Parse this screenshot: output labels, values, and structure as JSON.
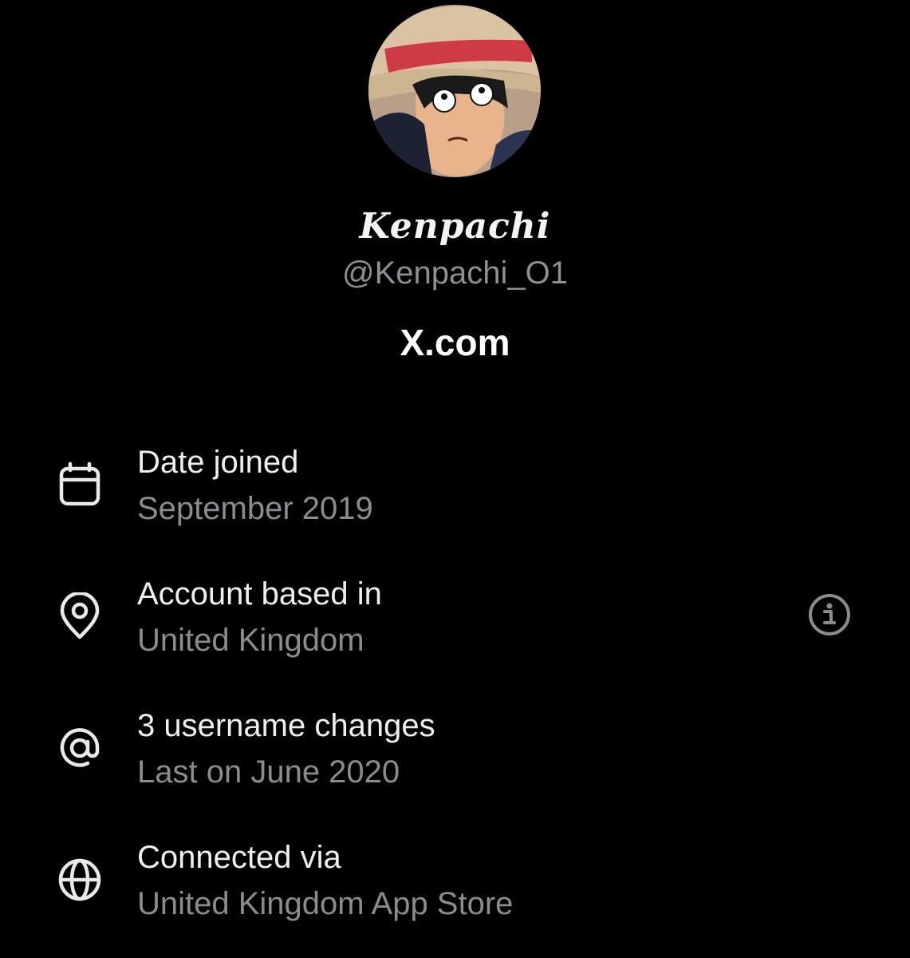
{
  "profile": {
    "display_name": "Kenpachi",
    "handle": "@Kenpachi_O1",
    "domain": "X.com",
    "avatar_icon": "anime-character-avatar"
  },
  "details": [
    {
      "icon": "calendar-icon",
      "title": "Date joined",
      "value": "September 2019"
    },
    {
      "icon": "location-pin-icon",
      "title": "Account based in",
      "value": "United Kingdom",
      "has_info": true
    },
    {
      "icon": "at-sign-icon",
      "title": "3 username changes",
      "value": "Last on June 2020"
    },
    {
      "icon": "globe-icon",
      "title": "Connected via",
      "value": "United Kingdom App Store"
    }
  ],
  "colors": {
    "background": "#000000",
    "primary_text": "#e7e9ea",
    "secondary_text": "#8a8c90",
    "icon": "#e7e9ea"
  }
}
